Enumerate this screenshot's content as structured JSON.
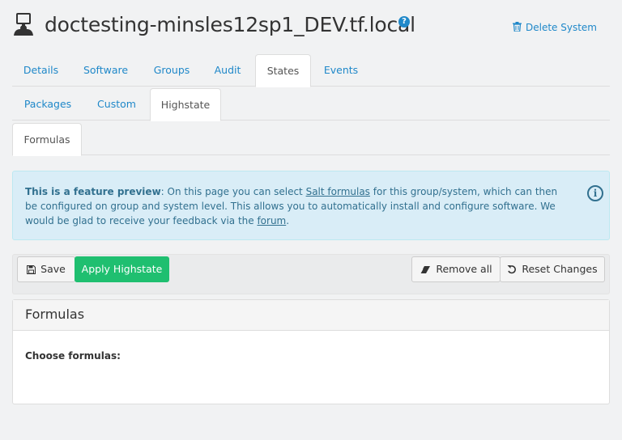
{
  "header": {
    "system_name": "doctesting-minsles12sp1_DEV.tf.local",
    "help_glyph": "?",
    "delete_label": "Delete System"
  },
  "tabs_level1": [
    {
      "label": "Details",
      "active": false
    },
    {
      "label": "Software",
      "active": false
    },
    {
      "label": "Groups",
      "active": false
    },
    {
      "label": "Audit",
      "active": false
    },
    {
      "label": "States",
      "active": true
    },
    {
      "label": "Events",
      "active": false
    }
  ],
  "tabs_level2": [
    {
      "label": "Packages",
      "active": false
    },
    {
      "label": "Custom",
      "active": false
    },
    {
      "label": "Highstate",
      "active": true
    }
  ],
  "tabs_level3": [
    {
      "label": "Formulas",
      "active": true
    }
  ],
  "info": {
    "lead": "This is a feature preview",
    "text1": ": On this page you can select ",
    "link1": "Salt formulas",
    "text2": " for this group/system, which can then be configured on group and system level. This allows you to automatically install and configure software. We would be glad to receive your feedback via the ",
    "link2": "forum",
    "text3": ".",
    "icon_glyph": "i"
  },
  "toolbar": {
    "save_label": "Save",
    "apply_label": "Apply Highstate",
    "remove_all_label": "Remove all",
    "reset_label": "Reset Changes"
  },
  "panel": {
    "title": "Formulas",
    "choose_label": "Choose formulas:"
  },
  "colors": {
    "link": "#1f88c9",
    "success": "#1fbf70",
    "info_bg": "#d9edf7",
    "info_text": "#31708f"
  }
}
